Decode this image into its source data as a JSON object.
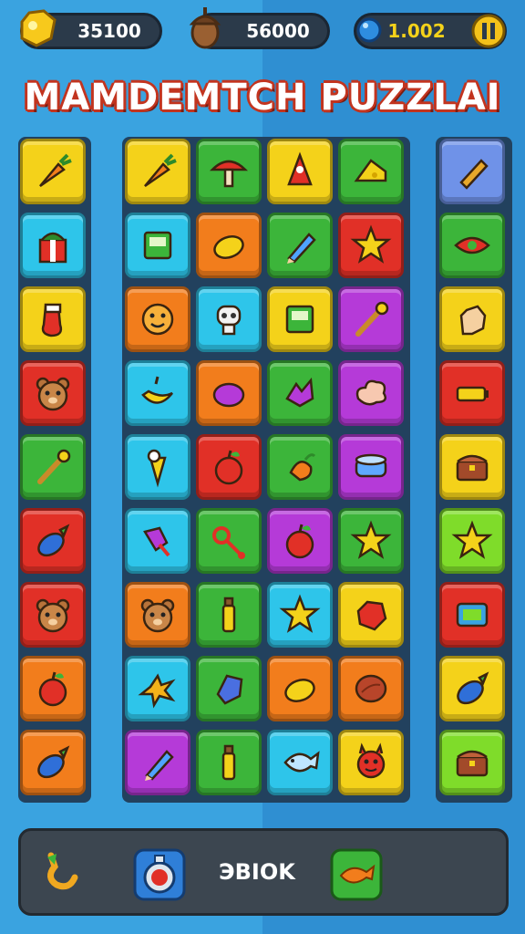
{
  "hud": {
    "coins": "35100",
    "acorns": "56000",
    "gems": "1.002",
    "pause_icon": "pause-icon"
  },
  "title": "MAMDEMTCH PUZZLAI",
  "colors": {
    "yellow": "#f4d21a",
    "green": "#3cb53a",
    "blue": "#2ec5ea",
    "orange": "#f27d1c",
    "red": "#e13027",
    "purple": "#b53ad8",
    "lime": "#7fdc2a",
    "periwinkle": "#6f92e8"
  },
  "board": {
    "columns": [
      {
        "name": "left",
        "tiles": [
          {
            "color": "yellow",
            "icon": "carrot-icon"
          },
          {
            "color": "blue",
            "icon": "gift-icon"
          },
          {
            "color": "yellow",
            "icon": "sock-icon"
          },
          {
            "color": "red",
            "icon": "bear-icon"
          },
          {
            "color": "green",
            "icon": "wand-icon"
          },
          {
            "color": "red",
            "icon": "eggplant-icon"
          },
          {
            "color": "red",
            "icon": "bear-icon"
          },
          {
            "color": "orange",
            "icon": "apple-icon"
          },
          {
            "color": "orange",
            "icon": "eggplant-icon"
          }
        ]
      },
      {
        "name": "middle",
        "rows": [
          [
            {
              "color": "yellow",
              "icon": "carrot-icon"
            },
            {
              "color": "green",
              "icon": "mushroom-icon"
            },
            {
              "color": "yellow",
              "icon": "cone-icon"
            },
            {
              "color": "green",
              "icon": "cheese-icon"
            }
          ],
          [
            {
              "color": "blue",
              "icon": "box-icon"
            },
            {
              "color": "orange",
              "icon": "lemon-icon"
            },
            {
              "color": "green",
              "icon": "pencil-icon"
            },
            {
              "color": "red",
              "icon": "star-icon"
            }
          ],
          [
            {
              "color": "orange",
              "icon": "smile-icon"
            },
            {
              "color": "blue",
              "icon": "skull-icon"
            },
            {
              "color": "yellow",
              "icon": "box-icon"
            },
            {
              "color": "purple",
              "icon": "wand-icon"
            }
          ],
          [
            {
              "color": "blue",
              "icon": "banana-icon"
            },
            {
              "color": "orange",
              "icon": "grape-icon"
            },
            {
              "color": "green",
              "icon": "leaf-icon"
            },
            {
              "color": "purple",
              "icon": "cloud-icon"
            }
          ],
          [
            {
              "color": "blue",
              "icon": "icecream-icon"
            },
            {
              "color": "red",
              "icon": "apple-icon"
            },
            {
              "color": "green",
              "icon": "pear-icon"
            },
            {
              "color": "purple",
              "icon": "drum-icon"
            }
          ],
          [
            {
              "color": "blue",
              "icon": "candy-icon"
            },
            {
              "color": "green",
              "icon": "key-icon"
            },
            {
              "color": "purple",
              "icon": "apple-icon"
            },
            {
              "color": "green",
              "icon": "star-icon"
            }
          ],
          [
            {
              "color": "orange",
              "icon": "bear-icon"
            },
            {
              "color": "green",
              "icon": "bottle-icon"
            },
            {
              "color": "blue",
              "icon": "star-icon"
            },
            {
              "color": "yellow",
              "icon": "gem-icon"
            }
          ],
          [
            {
              "color": "blue",
              "icon": "splat-icon"
            },
            {
              "color": "green",
              "icon": "crystal-icon"
            },
            {
              "color": "orange",
              "icon": "lemon-icon"
            },
            {
              "color": "orange",
              "icon": "nut-icon"
            }
          ],
          [
            {
              "color": "purple",
              "icon": "pencil-icon"
            },
            {
              "color": "green",
              "icon": "bottle-icon"
            },
            {
              "color": "blue",
              "icon": "fish-icon"
            },
            {
              "color": "yellow",
              "icon": "monster-icon"
            }
          ]
        ]
      },
      {
        "name": "right",
        "tiles": [
          {
            "color": "periwinkle",
            "icon": "scroll-icon"
          },
          {
            "color": "green",
            "icon": "eye-icon"
          },
          {
            "color": "yellow",
            "icon": "hand-icon"
          },
          {
            "color": "red",
            "icon": "battery-icon"
          },
          {
            "color": "yellow",
            "icon": "chest-icon"
          },
          {
            "color": "lime",
            "icon": "star-icon"
          },
          {
            "color": "red",
            "icon": "phone-icon"
          },
          {
            "color": "yellow",
            "icon": "eggplant-icon"
          },
          {
            "color": "lime",
            "icon": "chest-icon"
          }
        ]
      }
    ]
  },
  "bottom_bar": {
    "counter": "ЭВIOK",
    "left_icon": "hook-icon",
    "center_icon": "pot-icon",
    "right_icon": "fish-booster-icon"
  }
}
